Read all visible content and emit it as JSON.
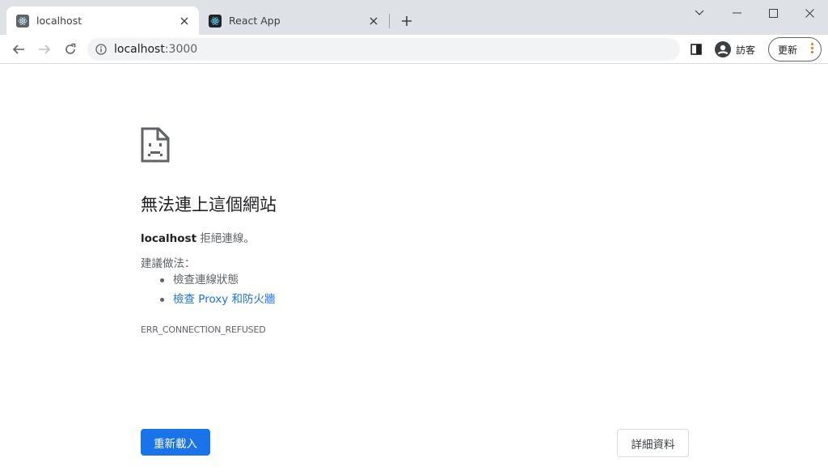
{
  "tabs": [
    {
      "title": "localhost",
      "favicon": "react-icon",
      "active": true
    },
    {
      "title": "React App",
      "favicon": "react-icon",
      "active": false
    }
  ],
  "toolbar": {
    "url_host": "localhost",
    "url_port": ":3000",
    "profile_label": "訪客",
    "update_label": "更新"
  },
  "error_page": {
    "heading": "無法連上這個網站",
    "host": "localhost",
    "summary_suffix": " 拒絕連線。",
    "suggestions_title": "建議做法：",
    "suggestions": [
      {
        "text": "檢查連線狀態",
        "link": false
      },
      {
        "text": "檢查 Proxy 和防火牆",
        "link": true
      }
    ],
    "error_code": "ERR_CONNECTION_REFUSED",
    "reload_label": "重新載入",
    "details_label": "詳細資料"
  },
  "colors": {
    "accent": "#1a73e8",
    "titlebar": "#dee1e6",
    "update_dots": "#e8710a"
  }
}
